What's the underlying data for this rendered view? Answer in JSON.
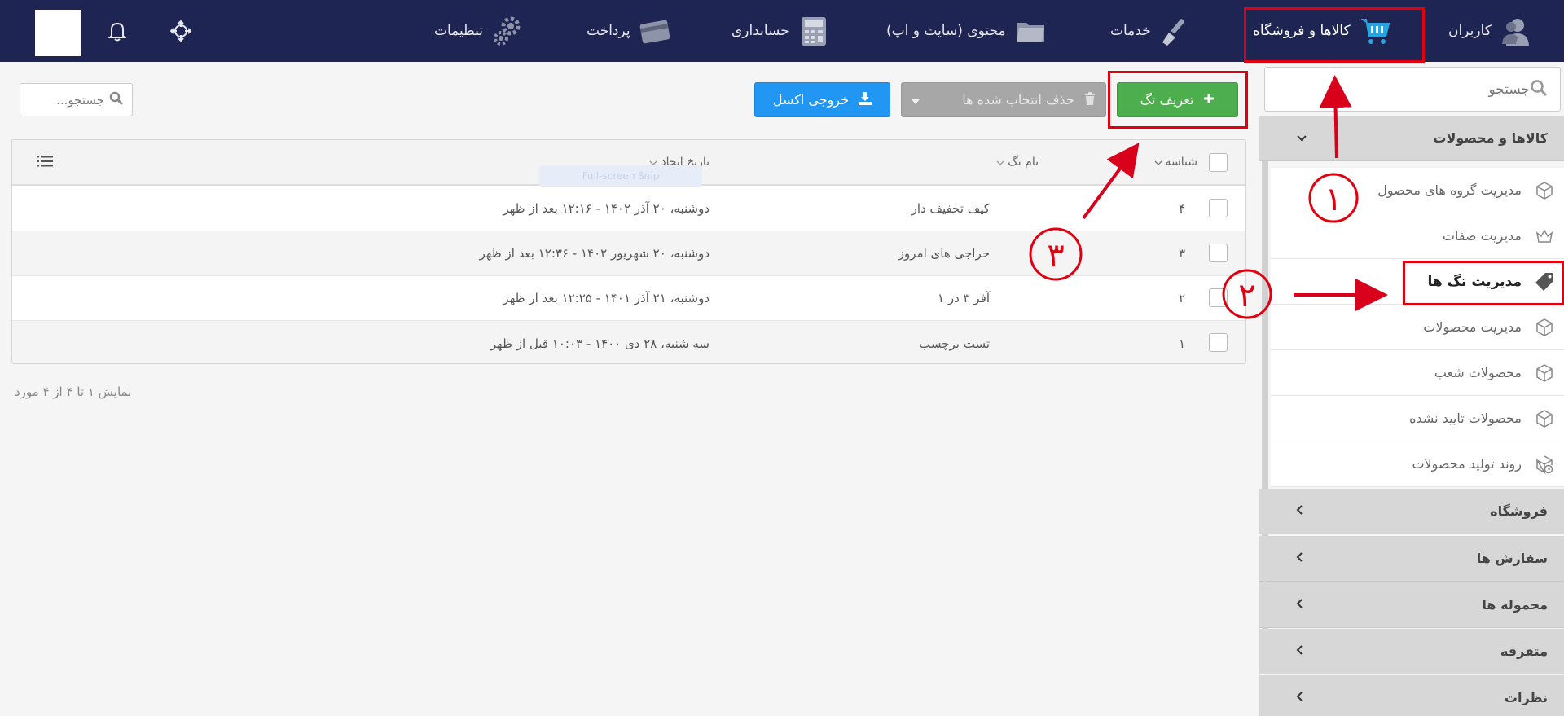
{
  "topnav": {
    "items": [
      {
        "label": "کاربران",
        "icon": "user-icon"
      },
      {
        "label": "کالاها و فروشگاه",
        "icon": "shopping-cart-icon",
        "active": true
      },
      {
        "label": "خدمات",
        "icon": "brush-icon"
      },
      {
        "label": "محتوی (سایت و اپ)",
        "icon": "folder-icon"
      },
      {
        "label": "حسابداری",
        "icon": "calculator-icon"
      },
      {
        "label": "پرداخت",
        "icon": "credit-card-icon"
      },
      {
        "label": "تنظیمات",
        "icon": "gear-icon"
      }
    ]
  },
  "sidebar": {
    "search_placeholder": "جستجو",
    "open_group": "کالاها و محصولات",
    "items": [
      {
        "label": "مدیریت گروه های محصول",
        "icon": "box-icon"
      },
      {
        "label": "مدیریت صفات",
        "icon": "crown-icon"
      },
      {
        "label": "مدیریت تگ ها",
        "icon": "tag-icon",
        "active": true
      },
      {
        "label": "مدیریت محصولات",
        "icon": "box-icon"
      },
      {
        "label": "محصولات شعب",
        "icon": "box-icon"
      },
      {
        "label": "محصولات تایید نشده",
        "icon": "box-icon"
      },
      {
        "label": "روند تولید محصولات",
        "icon": "box-clock-icon"
      }
    ],
    "groups": [
      "فروشگاه",
      "سفارش ها",
      "محموله ها",
      "متفرقه",
      "نظرات"
    ]
  },
  "toolbar": {
    "add_tag": "تعریف تگ",
    "delete_selected": "حذف انتخاب شده ها",
    "excel_export": "خروجی اکسل",
    "search_placeholder": "جستجو..."
  },
  "table": {
    "columns": {
      "id": "شناسه",
      "name": "نام تگ",
      "created": "تاریخ ایجاد"
    },
    "rows": [
      {
        "id": "۴",
        "name": "کیف تخفیف دار",
        "created": "دوشنبه، ۲۰ آذر ۱۴۰۲ - ۱۲:۱۶ بعد از ظهر"
      },
      {
        "id": "۳",
        "name": "حراجی های امروز",
        "created": "دوشنبه، ۲۰ شهریور ۱۴۰۲ - ۱۲:۳۶ بعد از ظهر"
      },
      {
        "id": "۲",
        "name": "آفر ۳ در ۱",
        "created": "دوشنبه، ۲۱ آذر ۱۴۰۱ - ۱۲:۲۵ بعد از ظهر"
      },
      {
        "id": "۱",
        "name": "تست برچسب",
        "created": "سه شنبه، ۲۸ دی ۱۴۰۰ - ۱۰:۰۳ قبل از ظهر"
      }
    ],
    "footer": "نمایش ۱ تا ۴ از ۴ مورد",
    "ghost_text": "Full-screen Snip"
  },
  "annotations": [
    "۱",
    "۲",
    "۳"
  ],
  "colors": {
    "nav_bg": "#1f2552",
    "green": "#4cae4c",
    "blue": "#2196f3",
    "annotation_red": "#e00010"
  }
}
